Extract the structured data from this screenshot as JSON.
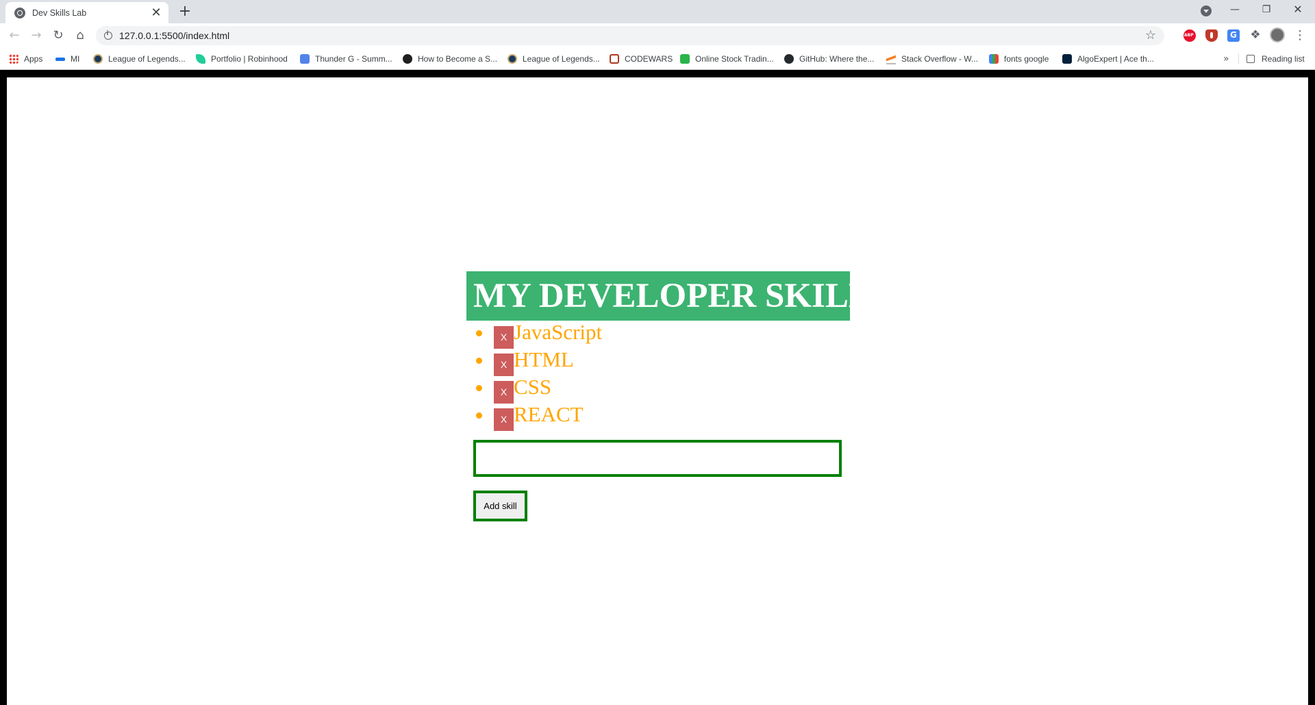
{
  "browser": {
    "tab_title": "Dev Skills Lab",
    "tab_close": "✕",
    "new_tab": "+",
    "url": "127.0.0.1:5500/index.html",
    "bookmarks": [
      {
        "label": "Apps",
        "icon": "apps-grid-icon",
        "color": "#ea4335"
      },
      {
        "label": "MI",
        "icon": "key-icon",
        "color": "#1a73e8"
      },
      {
        "label": "League of Legends...",
        "icon": "league-icon",
        "color": "#1a3a5c"
      },
      {
        "label": "Portfolio | Robinhood",
        "icon": "robinhood-feather-icon",
        "color": "#21ce99"
      },
      {
        "label": "Thunder G - Summ...",
        "icon": "opgg-icon",
        "color": "#5383e8"
      },
      {
        "label": "How to Become a S...",
        "icon": "codecademy-icon",
        "color": "#1f1f1f"
      },
      {
        "label": "League of Legends...",
        "icon": "league-icon",
        "color": "#1a3a5c"
      },
      {
        "label": "CODEWARS",
        "icon": "codewars-icon",
        "color": "#b1361e"
      },
      {
        "label": "Online Stock Tradin...",
        "icon": "td-icon",
        "color": "#2ab54a"
      },
      {
        "label": "GitHub: Where the...",
        "icon": "github-icon",
        "color": "#24292e"
      },
      {
        "label": "Stack Overflow - W...",
        "icon": "stackoverflow-icon",
        "color": "#f48024"
      },
      {
        "label": "fonts google",
        "icon": "google-fonts-icon",
        "color": "#4285f4"
      },
      {
        "label": "AlgoExpert | Ace th...",
        "icon": "algoexpert-icon",
        "color": "#02203c"
      }
    ],
    "bookmarks_more": "»",
    "reading_list": "Reading list"
  },
  "app": {
    "heading": "MY DEVELOPER SKILLS",
    "delete_label": "X",
    "skills": [
      "JavaScript",
      "HTML",
      "CSS",
      "REACT"
    ],
    "input_value": "",
    "add_button": "Add skill"
  },
  "colors": {
    "heading_bg": "#3cb371",
    "skill_text": "#ffa500",
    "delete_bg": "#cd5c5c",
    "border_green": "#008000"
  }
}
